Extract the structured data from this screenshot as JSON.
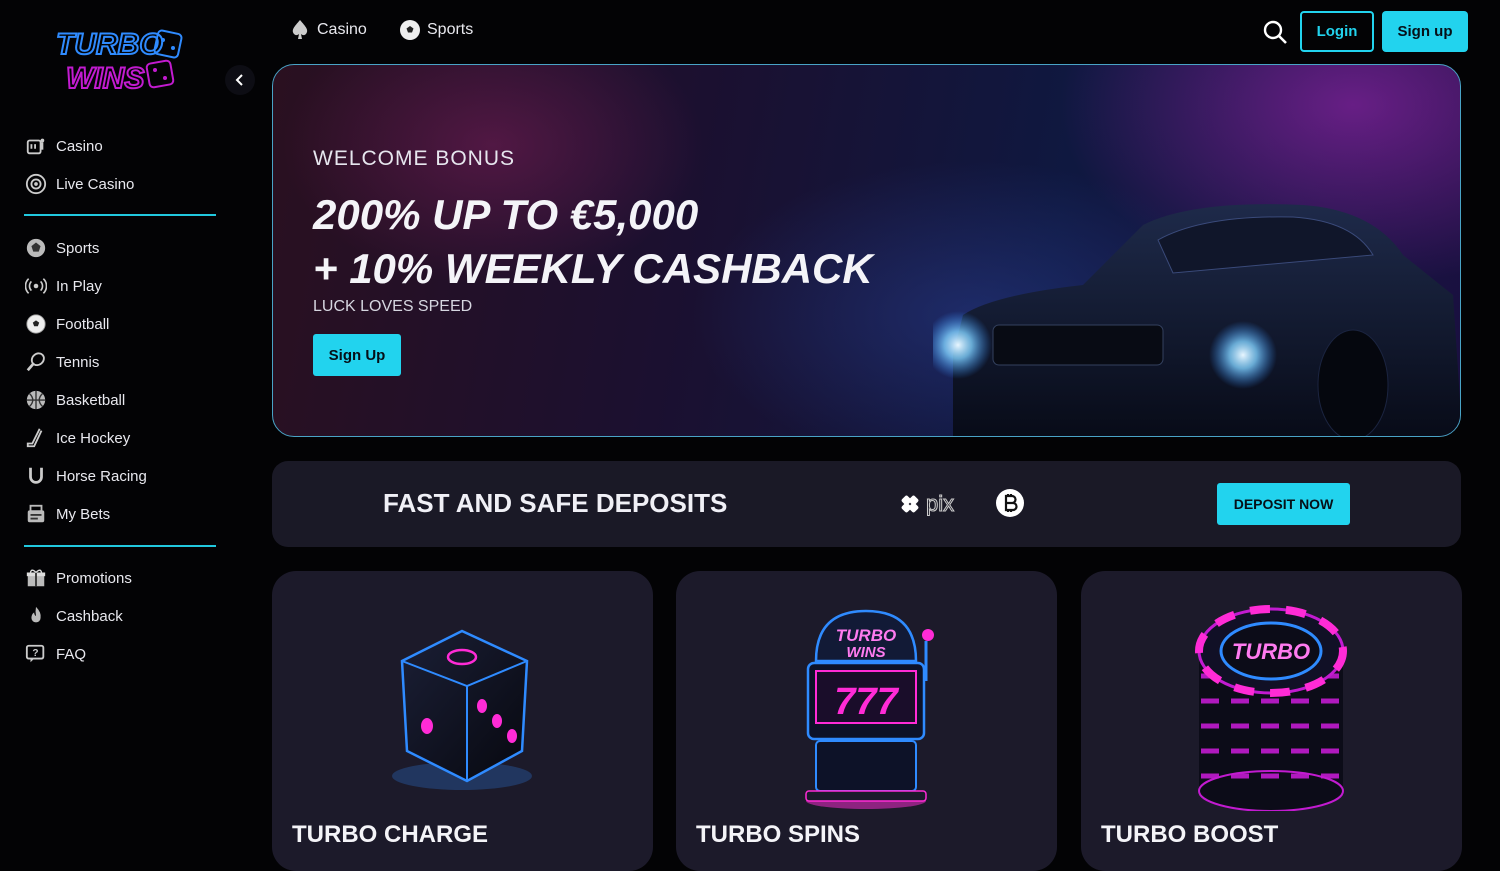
{
  "brand": {
    "logo_line1": "TURBO",
    "logo_line2": "WINS"
  },
  "sidebar": {
    "group1": [
      {
        "label": "Casino",
        "icon": "casino-icon"
      },
      {
        "label": "Live Casino",
        "icon": "live-casino-icon"
      }
    ],
    "group2": [
      {
        "label": "Sports",
        "icon": "sports-icon"
      },
      {
        "label": "In Play",
        "icon": "in-play-icon"
      },
      {
        "label": "Football",
        "icon": "football-icon"
      },
      {
        "label": "Tennis",
        "icon": "tennis-icon"
      },
      {
        "label": "Basketball",
        "icon": "basketball-icon"
      },
      {
        "label": "Ice Hockey",
        "icon": "ice-hockey-icon"
      },
      {
        "label": "Horse Racing",
        "icon": "horse-racing-icon"
      },
      {
        "label": "My Bets",
        "icon": "my-bets-icon"
      }
    ],
    "group3": [
      {
        "label": "Promotions",
        "icon": "gift-icon"
      },
      {
        "label": "Cashback",
        "icon": "flame-icon"
      },
      {
        "label": "FAQ",
        "icon": "faq-icon"
      }
    ]
  },
  "topnav": {
    "casino_label": "Casino",
    "sports_label": "Sports",
    "login_label": "Login",
    "signup_label": "Sign up"
  },
  "hero": {
    "kicker": "WELCOME BONUS",
    "line1": "200% UP TO €5,000",
    "line2": "+ 10% WEEKLY CASHBACK",
    "sub": "LUCK LOVES SPEED",
    "button_label": "Sign Up"
  },
  "deposit": {
    "title": "FAST AND SAFE DEPOSITS",
    "pix_text": "pix",
    "button_label": "DEPOSIT NOW"
  },
  "cards": [
    {
      "title": "TURBO CHARGE"
    },
    {
      "title": "TURBO SPINS",
      "art_text_1": "TURBO",
      "art_text_2": "WINS",
      "art_reels": "777"
    },
    {
      "title": "TURBO BOOST",
      "art_text": "TURBO"
    }
  ],
  "colors": {
    "accent": "#22d3ee",
    "neon_pink": "#ff2bd6",
    "neon_blue": "#2f8bff"
  }
}
